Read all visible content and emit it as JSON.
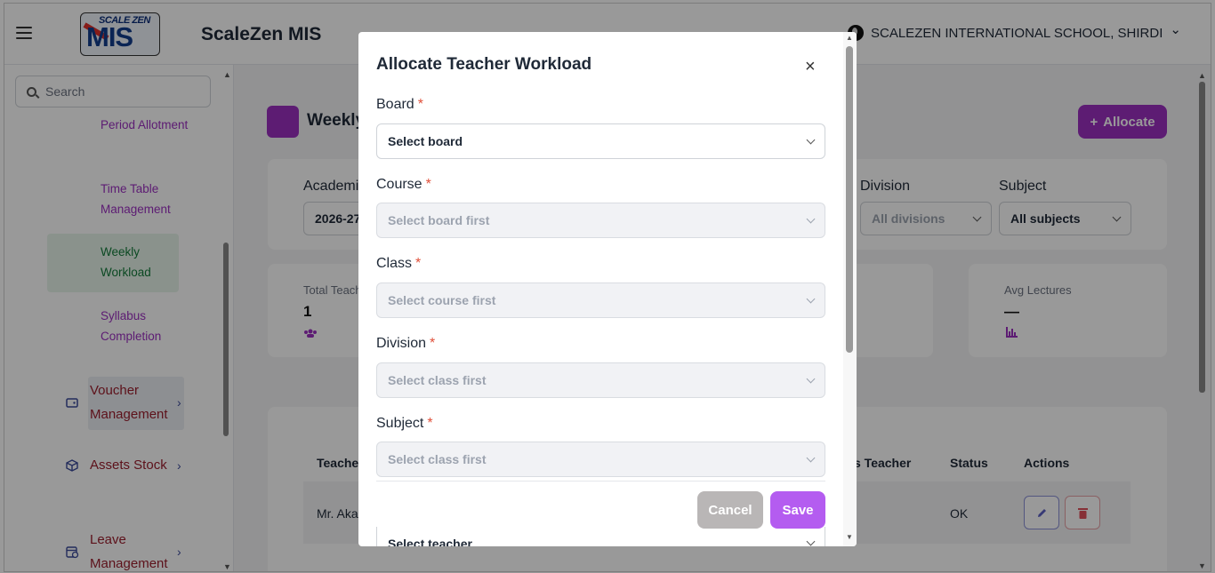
{
  "header": {
    "app_title": "ScaleZen MIS",
    "logo_top": "SCALE ZEN",
    "logo_main": "MIS",
    "school_name": "SCALEZEN INTERNATIONAL SCHOOL, SHIRDI",
    "school_chevron": "⌄"
  },
  "sidebar": {
    "search_placeholder": "Search",
    "sub_items": [
      "Period Allotment",
      "Time Table Management",
      "Weekly Workload",
      "Syllabus Completion"
    ],
    "groups": [
      {
        "label": "Voucher Management",
        "chevron": "›"
      },
      {
        "label": "Assets Stock",
        "chevron": "›"
      },
      {
        "label": "Leave Management",
        "chevron": "›"
      }
    ]
  },
  "main": {
    "title": "Weekly",
    "allocate_label": "Allocate",
    "allocate_icon": "+",
    "filters": {
      "academic_label": "Academic",
      "academic_value": "2026-27",
      "division_label": "Division",
      "division_value": "All divisions",
      "subject_label": "Subject",
      "subject_value": "All subjects"
    },
    "stats": {
      "total_label": "Total Teach",
      "total_value": "1",
      "avg_label": "Avg Lectures",
      "avg_value": "—"
    },
    "table": {
      "headers": {
        "teacher": "Teacher",
        "class_teacher": "s Teacher",
        "status": "Status",
        "actions": "Actions"
      },
      "row": {
        "teacher": "Mr. Aka",
        "status": "OK"
      }
    }
  },
  "modal": {
    "title": "Allocate Teacher Workload",
    "close": "×",
    "fields": [
      {
        "label": "Board",
        "required": "*",
        "value": "Select board",
        "disabled": false
      },
      {
        "label": "Course",
        "required": "*",
        "value": "Select board first",
        "disabled": true
      },
      {
        "label": "Class",
        "required": "*",
        "value": "Select course first",
        "disabled": true
      },
      {
        "label": "Division",
        "required": "*",
        "value": "Select class first",
        "disabled": true
      },
      {
        "label": "Subject",
        "required": "*",
        "value": "Select class first",
        "disabled": true
      }
    ],
    "teacher_value": "Select teacher",
    "cancel_label": "Cancel",
    "save_label": "Save"
  }
}
